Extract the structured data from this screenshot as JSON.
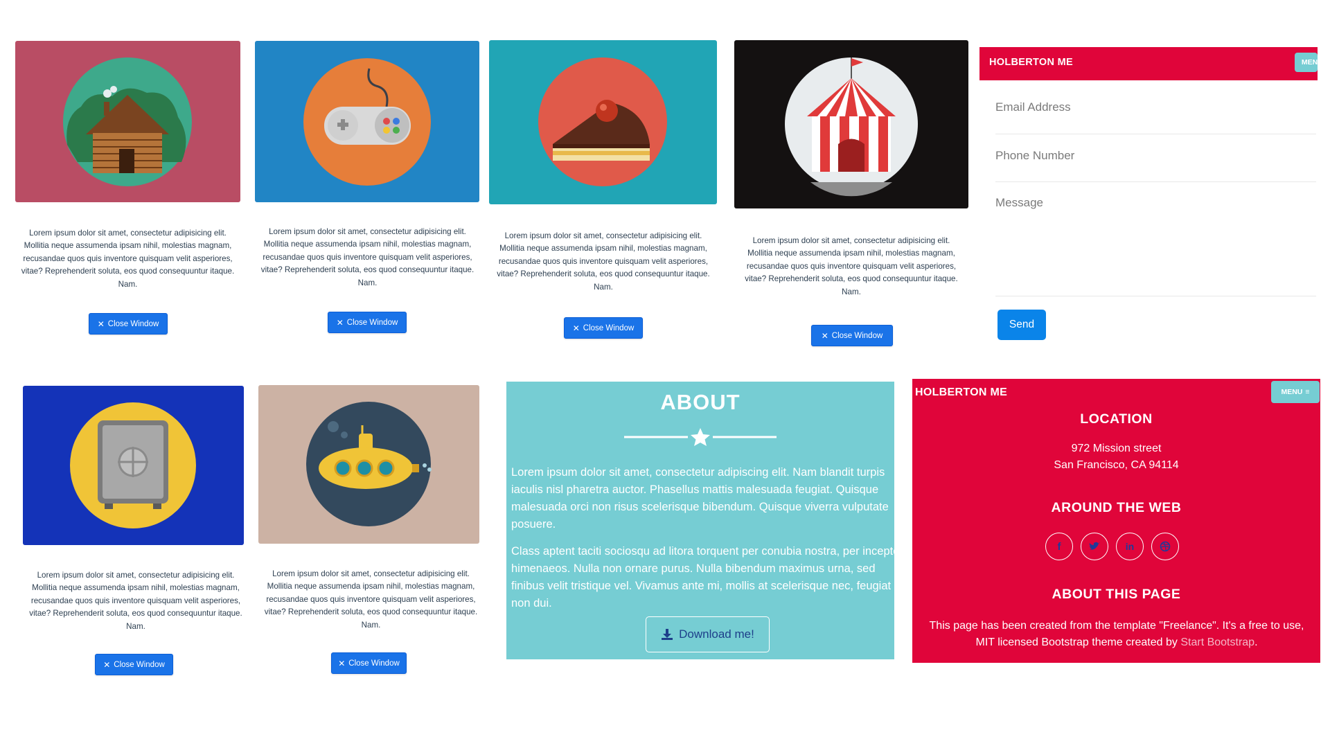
{
  "portfolio": {
    "description": "Lorem ipsum dolor sit amet, consectetur adipisicing elit. Mollitia neque assumenda ipsam nihil, molestias magnam, recusandae quos quis inventore quisquam velit asperiores, vitae? Reprehenderit soluta, eos quod consequuntur itaque. Nam.",
    "close_label": "Close Window",
    "items": [
      {
        "icon": "cabin-icon",
        "bg": "#b94d64"
      },
      {
        "icon": "game-controller-icon",
        "bg": "#2185c5"
      },
      {
        "icon": "cake-icon",
        "bg": "#21a5b5"
      },
      {
        "icon": "circus-tent-icon",
        "bg": "#141111"
      },
      {
        "icon": "safe-icon",
        "bg": "#1433b8"
      },
      {
        "icon": "submarine-icon",
        "bg": "#ccb2a4"
      }
    ]
  },
  "contact": {
    "brand": "HOLBERTON ME",
    "menu_label": "MEN",
    "fields": {
      "email_placeholder": "Email Address",
      "phone_placeholder": "Phone Number",
      "message_placeholder": "Message"
    },
    "send_label": "Send"
  },
  "about": {
    "title": "ABOUT",
    "paragraph1": "Lorem ipsum dolor sit amet, consectetur adipiscing elit. Nam blandit turpis iaculis nisl pharetra auctor. Phasellus mattis malesuada feugiat. Quisque malesuada orci non risus scelerisque bibendum. Quisque viverra vulputate posuere.",
    "paragraph2": "Class aptent taciti sociosqu ad litora torquent per conubia nostra, per inceptos himenaeos. Nulla non ornare purus. Nulla bibendum maximus urna, sed finibus velit tristique vel. Vivamus ante mi, mollis at scelerisque nec, feugiat non dui.",
    "download_label": "Download me!"
  },
  "footer": {
    "brand": "HOLBERTON ME",
    "menu_label": "MENU",
    "location_heading": "LOCATION",
    "address_line1": "972 Mission street",
    "address_line2": "San Francisco, CA 94114",
    "web_heading": "AROUND THE WEB",
    "social": [
      "facebook-icon",
      "twitter-icon",
      "linkedin-icon",
      "dribbble-icon"
    ],
    "about_heading": "ABOUT THIS PAGE",
    "about_text": "This page has been created from the template \"Freelance\". It's a free to use, MIT licensed Bootstrap theme created by",
    "about_link": "Start Bootstrap",
    "about_end": "."
  },
  "colors": {
    "primary_red": "#e0053a",
    "teal": "#76cdd3",
    "button_blue": "#1a73e8"
  }
}
